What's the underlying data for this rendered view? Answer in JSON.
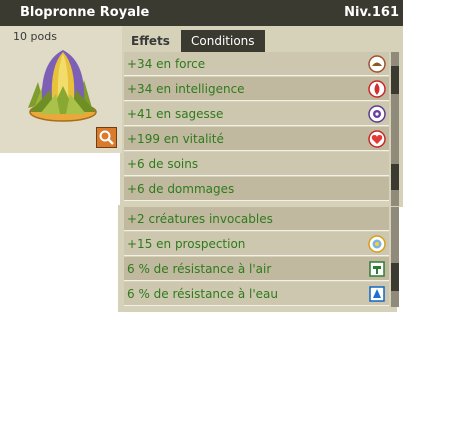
{
  "item": {
    "name": "Blopronne Royale",
    "level": "Niv.161",
    "weight": "10 pods"
  },
  "tabs": {
    "effects": "Effets",
    "conditions": "Conditions"
  },
  "effects": [
    {
      "text": "+34 en force",
      "icon": "earth-element-icon"
    },
    {
      "text": "+34 en intelligence",
      "icon": "fire-element-icon"
    },
    {
      "text": "+41 en sagesse",
      "icon": "wisdom-icon"
    },
    {
      "text": "+199 en vitalité",
      "icon": "vitality-heart-icon"
    },
    {
      "text": "+6 de soins",
      "icon": ""
    },
    {
      "text": "+6 de dommages",
      "icon": ""
    },
    {
      "text": "+2 créatures invocables",
      "icon": ""
    },
    {
      "text": "+15 en prospection",
      "icon": "prospection-icon"
    },
    {
      "text": "6 % de résistance à l'air",
      "icon": "air-element-icon"
    },
    {
      "text": "6 % de résistance à l'eau",
      "icon": "water-element-icon"
    }
  ],
  "colors": {
    "effect_text": "#2f7a1b",
    "titlebar": "#3b3a31",
    "panel": "#d6d2b9"
  }
}
